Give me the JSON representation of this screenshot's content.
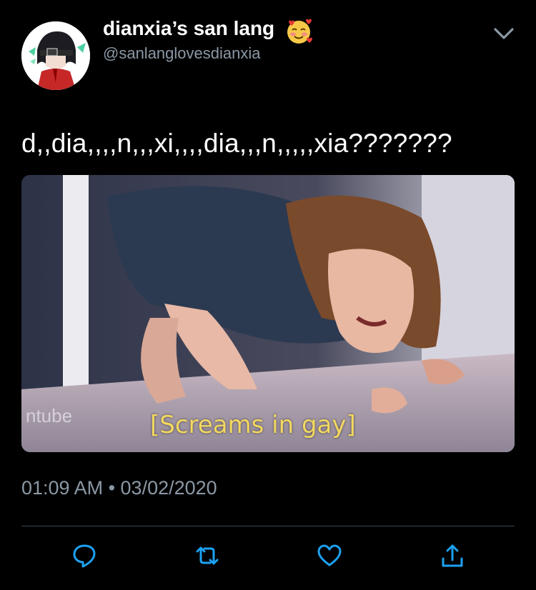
{
  "header": {
    "display_name": "dianxia’s san lang",
    "handle": "@sanlanglovesdianxia",
    "emoji": "smiling-face-with-hearts-icon",
    "menu_icon": "chevron-down-icon"
  },
  "tweet": {
    "text": "d,,dia,,,,n,,,xi,,,,dia,,,n,,,,,xia???????"
  },
  "media": {
    "caption": "[Screams in gay]",
    "watermark": "ntube"
  },
  "meta": {
    "timestamp": "01:09 AM • 03/02/2020"
  },
  "actions": {
    "icons": [
      "reply-icon",
      "retweet-icon",
      "like-icon",
      "share-icon"
    ]
  },
  "colors": {
    "background": "#000000",
    "primary_text": "#ffffff",
    "secondary_text": "#8b98a5",
    "icon_accent": "#1da1f2",
    "divider": "#38444d",
    "caption": "#f2d860"
  }
}
